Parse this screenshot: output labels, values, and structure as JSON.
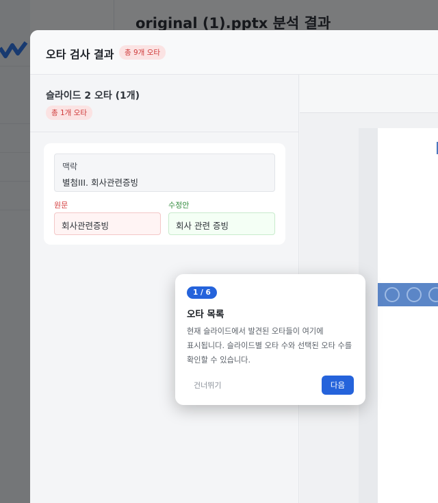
{
  "background": {
    "page_title": "original (1).pptx 분석 결과"
  },
  "modal": {
    "title": "오타 검사 결과",
    "total_badge": "총 9개 오타"
  },
  "slide_panel": {
    "title": "슬라이드 2 오타 (1개)",
    "badge": "총 1개 오타"
  },
  "typo_card": {
    "context_label": "맥락",
    "context_text": "별첨III. 회사관련증빙",
    "original_label": "원문",
    "original_text": "회사관련증빙",
    "fix_label": "수정안",
    "fix_text": "회사 관련 증빙"
  },
  "tour": {
    "step": "1 / 6",
    "title": "오타 목록",
    "description": "현재 슬라이드에서 발견된 오타들이 여기에 표시됩니다. 슬라이드별 오타 수와 선택된 오타 수를 확인할 수 있습니다.",
    "skip_label": "건너뛰기",
    "next_label": "다음"
  },
  "colors": {
    "primary": "#2563db",
    "error_red": "#d33b3b",
    "success_green": "#2f8a3a"
  }
}
